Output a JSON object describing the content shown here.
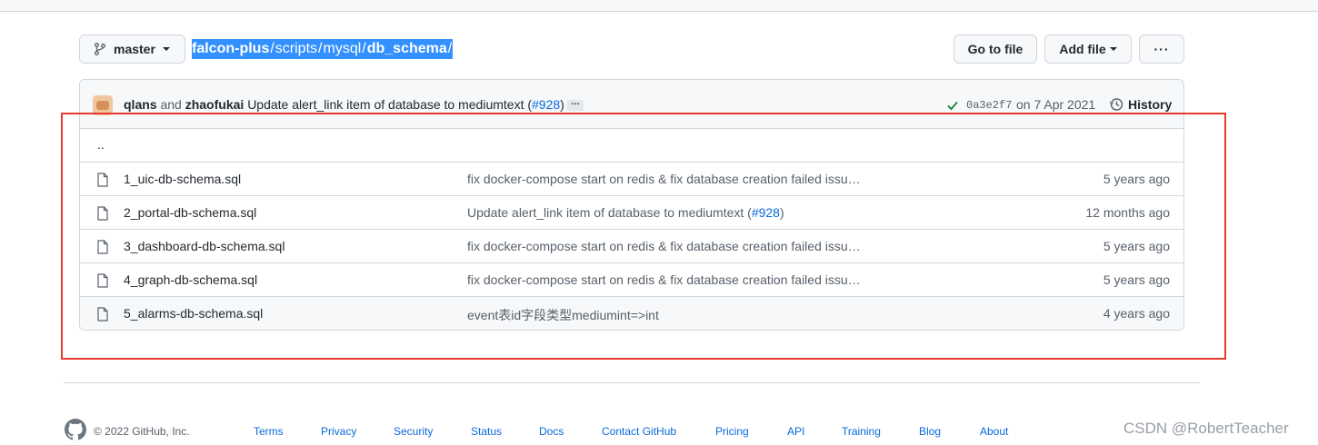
{
  "toolbar": {
    "branch": "master",
    "breadcrumb": [
      {
        "text": "falcon-plus",
        "bold": true
      },
      {
        "text": "scripts",
        "bold": false
      },
      {
        "text": "mysql",
        "bold": false
      },
      {
        "text": "db_schema",
        "bold": true
      }
    ],
    "separator": "/",
    "go_to_file": "Go to file",
    "add_file": "Add file",
    "more": "···"
  },
  "commit": {
    "author1": "qlans",
    "conjunction": "and",
    "author2": "zhaofukai",
    "message": "Update alert_link item of database to mediumtext (",
    "pr": "#928",
    "pr_close": ")",
    "ellipsis": "…",
    "sha": "0a3e2f7",
    "date": "on 7 Apr 2021",
    "history": "History"
  },
  "parent_dir": "..",
  "files": [
    {
      "name": "1_uic-db-schema.sql",
      "message": "fix docker-compose start on redis & fix database creation failed issu…",
      "pr": "",
      "age": "5 years ago"
    },
    {
      "name": "2_portal-db-schema.sql",
      "message": "Update alert_link item of database to mediumtext (",
      "pr": "#928",
      "age": "12 months ago"
    },
    {
      "name": "3_dashboard-db-schema.sql",
      "message": "fix docker-compose start on redis & fix database creation failed issu…",
      "pr": "",
      "age": "5 years ago"
    },
    {
      "name": "4_graph-db-schema.sql",
      "message": "fix docker-compose start on redis & fix database creation failed issu…",
      "pr": "",
      "age": "5 years ago"
    },
    {
      "name": "5_alarms-db-schema.sql",
      "message": "event表id字段类型mediumint=>int",
      "pr": "",
      "age": "4 years ago"
    }
  ],
  "footer": {
    "copyright": "© 2022 GitHub, Inc.",
    "links": [
      "Terms",
      "Privacy",
      "Security",
      "Status",
      "Docs",
      "Contact GitHub",
      "Pricing",
      "API",
      "Training",
      "Blog",
      "About"
    ]
  },
  "watermark": "CSDN @RobertTeacher",
  "colors": {
    "accent": "#0969da",
    "selection": "#3390ff",
    "annotation": "#e63b2e",
    "success": "#1a7f37"
  }
}
